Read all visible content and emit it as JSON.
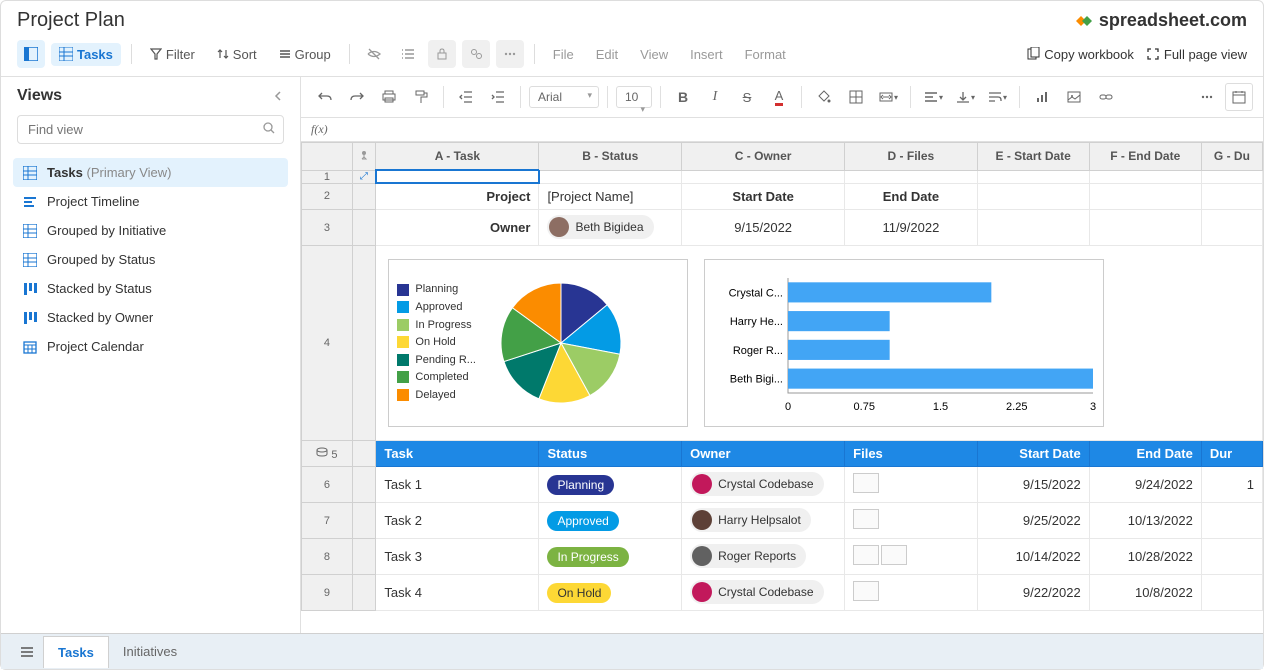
{
  "header": {
    "title": "Project Plan",
    "brand": "spreadsheet",
    "brand_suffix": ".com"
  },
  "toolbar1": {
    "tasks": "Tasks",
    "filter": "Filter",
    "sort": "Sort",
    "group": "Group",
    "menu_file": "File",
    "menu_edit": "Edit",
    "menu_view": "View",
    "menu_insert": "Insert",
    "menu_format": "Format",
    "copy_workbook": "Copy workbook",
    "full_page": "Full page view"
  },
  "sidebar": {
    "title": "Views",
    "search_placeholder": "Find view",
    "items": [
      {
        "icon": "grid",
        "label": "Tasks",
        "suffix": "(Primary View)",
        "active": true
      },
      {
        "icon": "timeline",
        "label": "Project Timeline"
      },
      {
        "icon": "grid",
        "label": "Grouped by Initiative"
      },
      {
        "icon": "grid",
        "label": "Grouped by Status"
      },
      {
        "icon": "kanban",
        "label": "Stacked by Status"
      },
      {
        "icon": "kanban",
        "label": "Stacked by Owner"
      },
      {
        "icon": "calendar",
        "label": "Project Calendar"
      }
    ]
  },
  "toolbar2": {
    "font": "Arial",
    "size": "10"
  },
  "formula_bar": {
    "fx": "f(x)"
  },
  "columns": [
    "",
    "",
    "A - Task",
    "B - Status",
    "C - Owner",
    "D - Files",
    "E - Start Date",
    "F - End Date",
    "G - Du"
  ],
  "meta_rows": {
    "project_label": "Project",
    "project_value": "[Project Name]",
    "start_label": "Start Date",
    "end_label": "End Date",
    "owner_label": "Owner",
    "owner_value": "Beth Bigidea",
    "date1": "9/15/2022",
    "date2": "11/9/2022"
  },
  "blue_header": [
    "Task",
    "Status",
    "Owner",
    "Files",
    "Start Date",
    "End Date",
    "Dur"
  ],
  "tasks": [
    {
      "n": "6",
      "task": "Task 1",
      "status": "Planning",
      "status_cls": "pill-planning",
      "owner": "Crystal Codebase",
      "avatar": "#c2185b",
      "files": 1,
      "start": "9/15/2022",
      "end": "9/24/2022",
      "dur": "1"
    },
    {
      "n": "7",
      "task": "Task 2",
      "status": "Approved",
      "status_cls": "pill-approved",
      "owner": "Harry Helpsalot",
      "avatar": "#5d4037",
      "files": 1,
      "start": "9/25/2022",
      "end": "10/13/2022",
      "dur": ""
    },
    {
      "n": "8",
      "task": "Task 3",
      "status": "In Progress",
      "status_cls": "pill-inprogress",
      "owner": "Roger Reports",
      "avatar": "#616161",
      "files": 2,
      "start": "10/14/2022",
      "end": "10/28/2022",
      "dur": ""
    },
    {
      "n": "9",
      "task": "Task 4",
      "status": "On Hold",
      "status_cls": "pill-onhold",
      "owner": "Crystal Codebase",
      "avatar": "#c2185b",
      "files": 1,
      "start": "9/22/2022",
      "end": "10/8/2022",
      "dur": ""
    }
  ],
  "bottom_tabs": {
    "tasks": "Tasks",
    "initiatives": "Initiatives"
  },
  "chart_data": [
    {
      "type": "pie",
      "series": [
        {
          "name": "Planning",
          "value": 14,
          "color": "#283593"
        },
        {
          "name": "Approved",
          "value": 14,
          "color": "#039be5"
        },
        {
          "name": "In Progress",
          "value": 14,
          "color": "#9ccc65"
        },
        {
          "name": "On Hold",
          "value": 14,
          "color": "#fdd835"
        },
        {
          "name": "Pending R...",
          "value": 14,
          "color": "#00796b"
        },
        {
          "name": "Completed",
          "value": 15,
          "color": "#43a047"
        },
        {
          "name": "Delayed",
          "value": 15,
          "color": "#fb8c00"
        }
      ]
    },
    {
      "type": "bar",
      "orientation": "horizontal",
      "categories": [
        "Crystal C...",
        "Harry He...",
        "Roger R...",
        "Beth Bigi..."
      ],
      "values": [
        2.0,
        1.0,
        1.0,
        3.0
      ],
      "xlim": [
        0,
        3
      ],
      "xticks": [
        0,
        0.75,
        1.5,
        2.25,
        3
      ],
      "color": "#42a5f5"
    }
  ]
}
